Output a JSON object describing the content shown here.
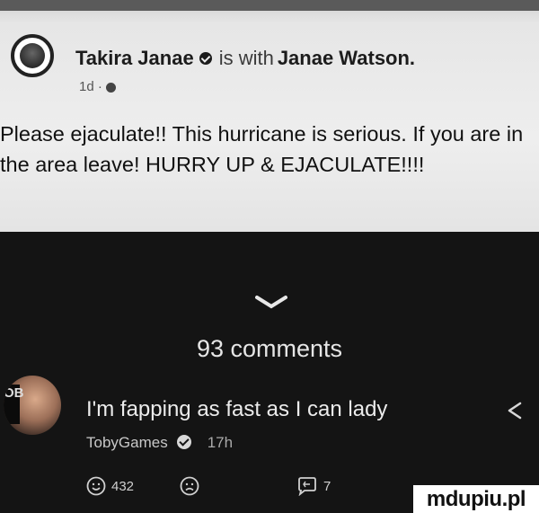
{
  "post": {
    "author": "Takira Janae",
    "with_text": "is with",
    "tagged": "Janae Watson.",
    "time": "1d ·",
    "body": "Please ejaculate!! This hurricane is serious. If you are in the area leave! HURRY UP & EJACULATE!!!!",
    "icons": {
      "avatar": "profile-avatar",
      "verified": "verified-badge-icon",
      "privacy": "globe-icon"
    }
  },
  "comments_section": {
    "count_label": "93 comments",
    "comment": {
      "text": "I'm fapping as fast as I can lady",
      "author": "TobyGames",
      "time": "17h",
      "avatar_badge_text": "OB"
    },
    "actions": {
      "likes": "432",
      "replies": "7"
    }
  },
  "watermark": "mdupiu.pl",
  "colors": {
    "post_bg": "#eeeeee",
    "dark_bg": "#141414",
    "text_light": "#ececec"
  }
}
